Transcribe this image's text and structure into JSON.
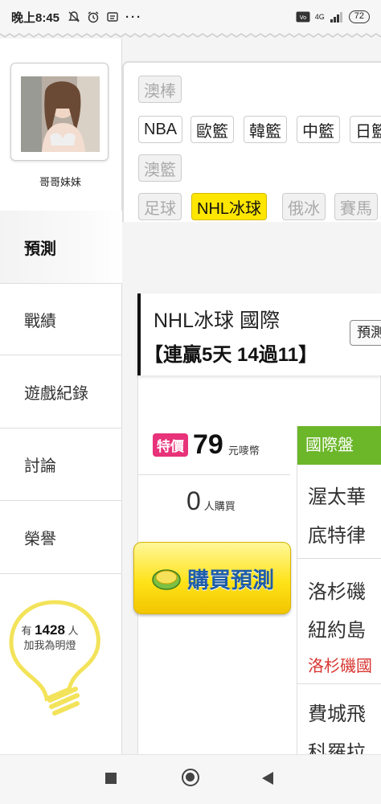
{
  "status_bar": {
    "time": "晚上8:45",
    "battery": "72",
    "network": "4G"
  },
  "profile": {
    "username": "哥哥妹妹"
  },
  "menu": [
    {
      "label": "預測",
      "active": true
    },
    {
      "label": "戰績"
    },
    {
      "label": "遊戲紀錄"
    },
    {
      "label": "討論"
    },
    {
      "label": "榮譽"
    }
  ],
  "fans": {
    "prefix": "有",
    "count": "1428",
    "suffix": "人",
    "action": "加我為明燈"
  },
  "sport_tabs": {
    "row0": [
      "澳棒"
    ],
    "row1": [
      "NBA",
      "歐籃",
      "韓籃",
      "中籃",
      "日籃"
    ],
    "row2": [
      "澳籃"
    ],
    "row3": [
      "足球",
      "NHL冰球",
      "俄冰",
      "賽馬"
    ],
    "active": "NHL冰球"
  },
  "prediction": {
    "title": "NHL冰球 國際",
    "streak": "【連贏5天 14過11】",
    "predict_button": "預測",
    "special_badge": "特價",
    "price": "79",
    "price_unit": "元嘜幣",
    "buyers": "0",
    "buyers_unit": "人購買",
    "buy_button": "購買預測"
  },
  "market": {
    "header": "國際盤",
    "games": [
      {
        "lines": [
          "渥太華",
          "底特律"
        ]
      },
      {
        "lines": [
          "洛杉磯",
          "紐約島"
        ],
        "pick": "洛杉磯國"
      },
      {
        "lines": [
          "費城飛",
          "科羅拉"
        ]
      }
    ]
  },
  "colors": {
    "accent_yellow": "#ffe600",
    "market_green": "#6cb62a",
    "special_pink": "#e8327a",
    "pick_red": "#d9352f",
    "buy_text_blue": "#1f5da8"
  }
}
